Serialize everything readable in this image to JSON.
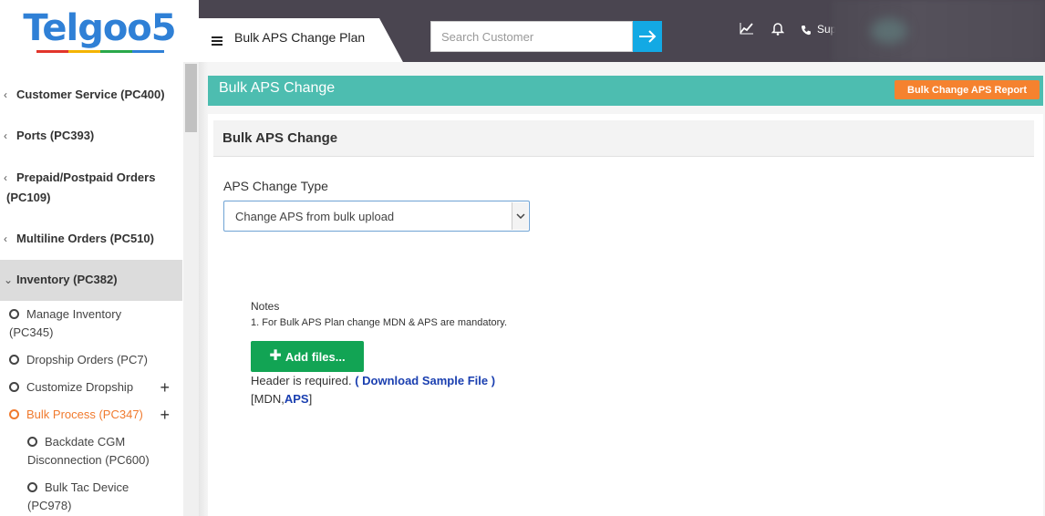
{
  "logo": {
    "text": "Telgoo5",
    "underline_colors": [
      "#e2352b",
      "#f4b400",
      "#2aa84a",
      "#2f80d6"
    ]
  },
  "sidebar": {
    "items": [
      {
        "label": "Customer Service (PC400)",
        "icon": "chevron-left-icon"
      },
      {
        "label": "Ports (PC393)",
        "icon": "chevron-left-icon"
      },
      {
        "label": "Prepaid/Postpaid Orders",
        "label2": "(PC109)",
        "icon": "chevron-left-icon"
      },
      {
        "label": "Multiline Orders (PC510)",
        "icon": "chevron-left-icon"
      },
      {
        "label": "Inventory (PC382)",
        "icon": "chevron-down-icon"
      }
    ],
    "sub_items": [
      {
        "label": "Manage Inventory",
        "label2": "(PC345)"
      },
      {
        "label": "Dropship Orders (PC7)"
      },
      {
        "label": "Customize Dropship",
        "plus": "+"
      },
      {
        "label": "Bulk Process (PC347)",
        "plus": "+"
      },
      {
        "label": "Backdate CGM",
        "label2": "Disconnection (PC600)"
      },
      {
        "label": "Bulk Tac Device",
        "label2": "(PC978)"
      }
    ]
  },
  "header": {
    "page_title": "Bulk APS Change Plan",
    "search_placeholder": "Search Customer",
    "search_button_icon": "arrow-right-icon",
    "icons": [
      "chart-icon",
      "bell-icon",
      "phone-icon"
    ],
    "support_text": "Sup"
  },
  "banner": {
    "title": "Bulk APS Change",
    "report_button": "Bulk Change APS Report"
  },
  "card": {
    "title": "Bulk APS Change",
    "field_label": "APS Change Type",
    "select_value": "Change APS from bulk upload",
    "notes_title": "Notes",
    "notes_line": "1. For Bulk APS Plan change MDN & APS are mandatory.",
    "add_files_label": "Add files...",
    "header_required": "Header is required.",
    "download_link": "( Download Sample File )",
    "mdn_prefix": "[MDN,",
    "mdn_aps": "APS",
    "mdn_suffix": "]"
  },
  "colors": {
    "topbar": "#4a4550",
    "banner": "#4dbdb0",
    "report_button": "#f5822f",
    "add_button": "#12a454",
    "search_button": "#13a9e4",
    "active_link": "#f07a2e"
  }
}
